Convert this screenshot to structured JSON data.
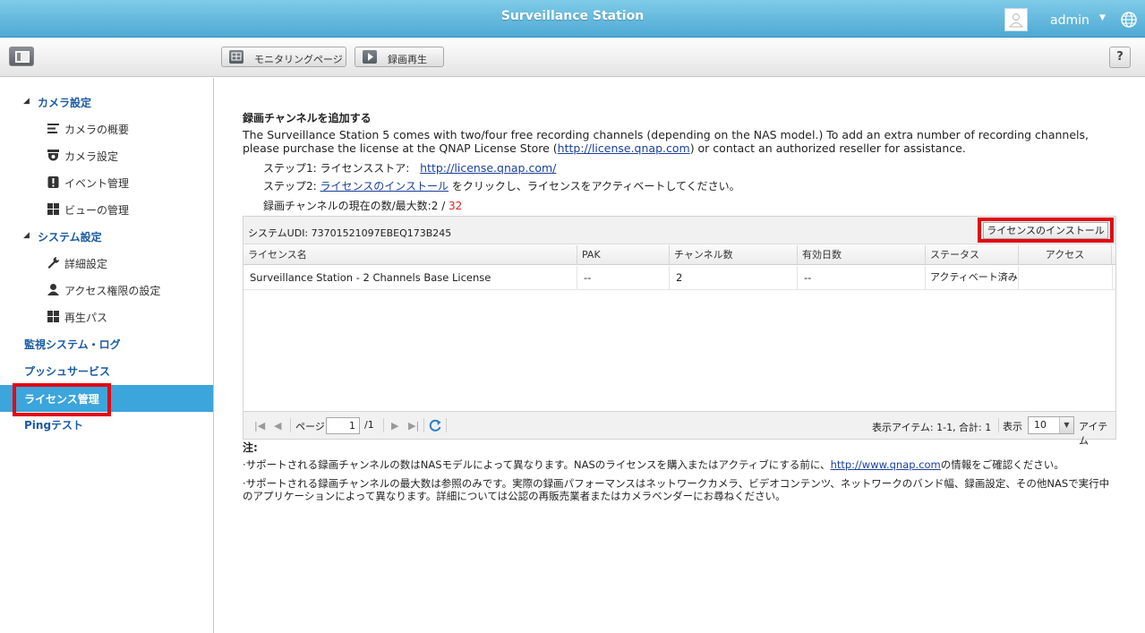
{
  "app": {
    "title": "Surveillance Station",
    "user": "admin"
  },
  "toolbar": {
    "monitor_label": "モニタリングページ",
    "playback_label": "録画再生",
    "help_label": "?"
  },
  "sidebar": {
    "camera_group": "カメラ設定",
    "camera_items": [
      "カメラの概要",
      "カメラ設定",
      "イベント管理",
      "ビューの管理"
    ],
    "system_group": "システム設定",
    "system_items": [
      "詳細設定",
      "アクセス権限の設定",
      "再生パス"
    ],
    "top_items": [
      "監視システム・ログ",
      "プッシュサービス",
      "ライセンス管理",
      "Pingテスト"
    ],
    "active": "ライセンス管理"
  },
  "main": {
    "title": "録画チャンネルを追加する",
    "desc_before": "The Surveillance Station 5 comes with two/four free recording channels (depending on the NAS model.) To add an extra number of recording channels, please purchase the license at the QNAP License Store (",
    "desc_link": "http://license.qnap.com",
    "desc_after": ") or contact an authorized reseller for assistance.",
    "step1_label": "ステップ1: ライセンスストア:",
    "step1_link": "http://license.qnap.com/",
    "step2_label": "ステップ2:",
    "step2_link": "ライセンスのインストール",
    "step2_after": "をクリックし、ライセンスをアクティベートしてください。",
    "count_label": "録画チャンネルの現在の数/最大数:",
    "count_current": "2",
    "count_sep": " / ",
    "count_max": "32"
  },
  "grid": {
    "udi": "システムUDI: 73701521097EBEQ173B245",
    "install_button": "ライセンスのインストール",
    "headers": [
      "ライセンス名",
      "PAK",
      "チャンネル数",
      "有効日数",
      "ステータス",
      "アクセス"
    ],
    "rows": [
      [
        "Surveillance Station - 2 Channels Base License",
        "--",
        "2",
        "--",
        "アクティベート済み",
        ""
      ]
    ]
  },
  "pager": {
    "page_label": "ページ",
    "page_value": "1",
    "page_total": "/1",
    "info": "表示アイテム: 1-1, 合計: 1",
    "show_label": "表示",
    "per_page": "10",
    "items_label": "アイテム"
  },
  "notes": {
    "title": "注:",
    "note1_before": "·サポートされる録画チャンネルの数はNASモデルによって異なります。NASのライセンスを購入またはアクティブにする前に、",
    "note1_link": "http://www.qnap.com",
    "note1_after": "の情報をご確認ください。",
    "note2": "·サポートされる録画チャンネルの最大数は参照のみです。実際の録画パフォーマンスはネットワークカメラ、ビデオコンテンツ、ネットワークのバンド幅、録画設定、その他NASで実行中のアプリケーションによって異なります。詳細については公認の再販売業者またはカメラベンダーにお尋ねください。"
  },
  "colors": {
    "accent": "#3ba5dc",
    "titlebar": "#5bb5dc",
    "highlight": "#e30613",
    "link": "#1a3f9c",
    "max_count": "#e0201b"
  }
}
